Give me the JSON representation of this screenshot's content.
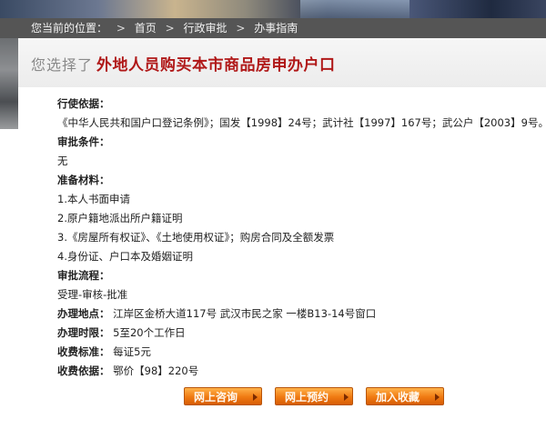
{
  "breadcrumb": {
    "prefix": "您当前的位置：",
    "items": [
      "首页",
      "行政审批",
      "办事指南"
    ],
    "separator": ">"
  },
  "selection": {
    "prefix": "您选择了",
    "title": "外地人员购买本市商品房申办户口"
  },
  "sections": {
    "basis_head": "行使依据：",
    "basis_text": "《中华人民共和国户口登记条例》；国发【1998】24号；武计社【1997】167号；武公户【2003】9号。",
    "conditions_head": "审批条件：",
    "conditions_text": "无",
    "materials_head": "准备材料：",
    "materials": [
      "1.本人书面申请",
      "2.原户籍地派出所户籍证明",
      "3.《房屋所有权证》、《土地使用权证》；购房合同及全额发票",
      "4.身份证、户口本及婚姻证明"
    ],
    "process_head": "审批流程：",
    "process_text": "受理-审核-批准",
    "location_label": "办理地点：",
    "location_value": "江岸区金桥大道117号 武汉市民之家 一楼B13-14号窗口",
    "time_label": "办理时限：",
    "time_value": "5至20个工作日",
    "fee_label": "收费标准：",
    "fee_value": "每证5元",
    "fee_basis_label": "收费依据：",
    "fee_basis_value": "鄂价【98】220号"
  },
  "buttons": {
    "consult": "网上咨询",
    "appointment": "网上预约",
    "favorite": "加入收藏"
  },
  "colors": {
    "title_red": "#b01818",
    "crumb_bg": "#555555",
    "button_orange": "#f07a12"
  }
}
